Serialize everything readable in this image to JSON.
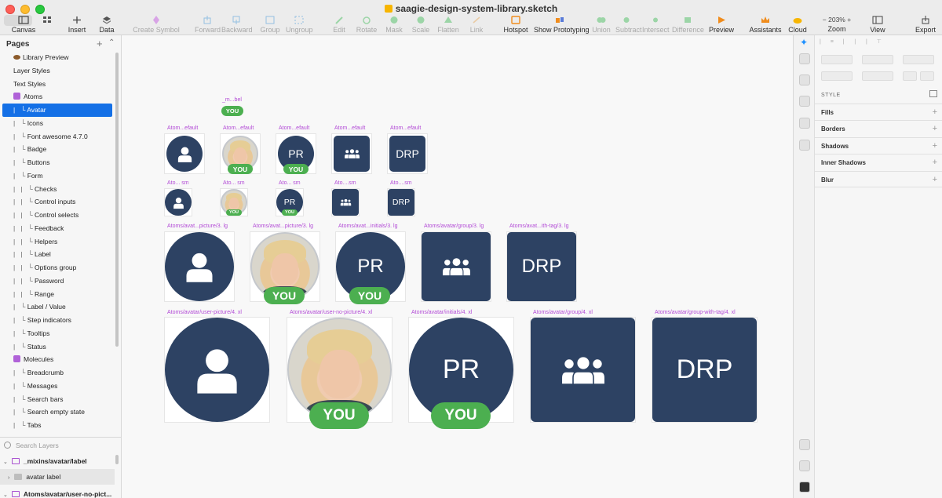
{
  "window": {
    "title": "saagie-design-system-library.sketch"
  },
  "toolbar": {
    "canvas": "Canvas",
    "insert": "Insert",
    "data": "Data",
    "create_symbol": "Create Symbol",
    "forward": "Forward",
    "backward": "Backward",
    "group": "Group",
    "ungroup": "Ungroup",
    "edit": "Edit",
    "rotate": "Rotate",
    "mask": "Mask",
    "scale": "Scale",
    "flatten": "Flatten",
    "link": "Link",
    "hotspot": "Hotspot",
    "show_prototyping": "Show Prototyping",
    "union": "Union",
    "subtract": "Subtract",
    "intersect": "Intersect",
    "difference": "Difference",
    "preview": "Preview",
    "assistants": "Assistants",
    "cloud": "Cloud",
    "zoom_value": "203%",
    "zoom": "Zoom",
    "view": "View",
    "export": "Export"
  },
  "sidebar": {
    "pages_header": "Pages",
    "pages": [
      {
        "label": "Library Preview",
        "indent": "",
        "icon": "eye"
      },
      {
        "label": "Layer Styles",
        "indent": "",
        "icon": ""
      },
      {
        "label": "Text Styles",
        "indent": "",
        "icon": ""
      },
      {
        "label": "Atoms",
        "indent": "",
        "icon": "emoji"
      },
      {
        "label": "Avatar",
        "indent": "|   └ ",
        "icon": "",
        "selected": true
      },
      {
        "label": "Icons",
        "indent": "|   └ ",
        "icon": ""
      },
      {
        "label": "Font awesome 4.7.0",
        "indent": "|   └ ",
        "icon": ""
      },
      {
        "label": "Badge",
        "indent": "|   └ ",
        "icon": ""
      },
      {
        "label": "Buttons",
        "indent": "|   └ ",
        "icon": ""
      },
      {
        "label": "Form",
        "indent": "|   └ ",
        "icon": ""
      },
      {
        "label": "Checks",
        "indent": "|   |   └ ",
        "icon": ""
      },
      {
        "label": "Control inputs",
        "indent": "|   |   └ ",
        "icon": ""
      },
      {
        "label": "Control selects",
        "indent": "|   |   └ ",
        "icon": ""
      },
      {
        "label": "Feedback",
        "indent": "|   |   └ ",
        "icon": ""
      },
      {
        "label": "Helpers",
        "indent": "|   |   └ ",
        "icon": ""
      },
      {
        "label": "Label",
        "indent": "|   |   └ ",
        "icon": ""
      },
      {
        "label": "Options group",
        "indent": "|   |   └ ",
        "icon": ""
      },
      {
        "label": "Password",
        "indent": "|   |   └ ",
        "icon": ""
      },
      {
        "label": "Range",
        "indent": "|   |   └ ",
        "icon": ""
      },
      {
        "label": "Label / Value",
        "indent": "|   └ ",
        "icon": ""
      },
      {
        "label": "Step indicators",
        "indent": "|   └ ",
        "icon": ""
      },
      {
        "label": "Tooltips",
        "indent": "|   └ ",
        "icon": ""
      },
      {
        "label": "Status",
        "indent": "|   └ ",
        "icon": ""
      },
      {
        "label": "Molecules",
        "indent": "",
        "icon": "emoji"
      },
      {
        "label": "Breadcrumb",
        "indent": "|   └ ",
        "icon": ""
      },
      {
        "label": "Messages",
        "indent": "|   └ ",
        "icon": ""
      },
      {
        "label": "Search bars",
        "indent": "|   └ ",
        "icon": ""
      },
      {
        "label": "Search empty state",
        "indent": "|   └ ",
        "icon": ""
      },
      {
        "label": "Tabs",
        "indent": "|   └ ",
        "icon": ""
      }
    ],
    "search_placeholder": "Search Layers",
    "layers": [
      {
        "label": "_mixins/avatar/label",
        "kind": "artboard"
      },
      {
        "label": "avatar label",
        "kind": "group"
      },
      {
        "label": "Atoms/avatar/user-no-pict...",
        "kind": "artboard"
      }
    ]
  },
  "canvas": {
    "mixin_label": "_m...bel",
    "you_text": "YOU",
    "initials": "PR",
    "group_initials": "DRP",
    "row_md_labels": [
      "Atom...efault",
      "Atom...efault",
      "Atom...efault",
      "Atom...efault",
      "Atom...efault"
    ],
    "row_sm_labels": [
      "Ato... sm",
      "Ato... sm",
      "Ato... sm",
      "Ato....sm",
      "Ato....sm"
    ],
    "row_lg_labels": [
      "Atoms/avat...picture/3. lg",
      "Atoms/avat...picture/3. lg",
      "Atoms/avat...initials/3. lg",
      "Atoms/avatar/group/3. lg",
      "Atoms/avat...ith-tag/3. lg"
    ],
    "row_xl_labels": [
      "Atoms/avatar/user-picture/4. xl",
      "Atoms/avatar/user-no-picture/4. xl",
      "Atoms/avatar/initials/4. xl",
      "Atoms/avatar/group/4. xl",
      "Atoms/avatar/group-with-tag/4. xl"
    ]
  },
  "inspector": {
    "style_header": "STYLE",
    "sections": [
      "Fills",
      "Borders",
      "Shadows",
      "Inner Shadows",
      "Blur"
    ]
  },
  "colors": {
    "avatar_fill": "#2d4263",
    "you_tag": "#4caf50",
    "artboard_label": "#b24ad6",
    "selection": "#1470e6"
  }
}
